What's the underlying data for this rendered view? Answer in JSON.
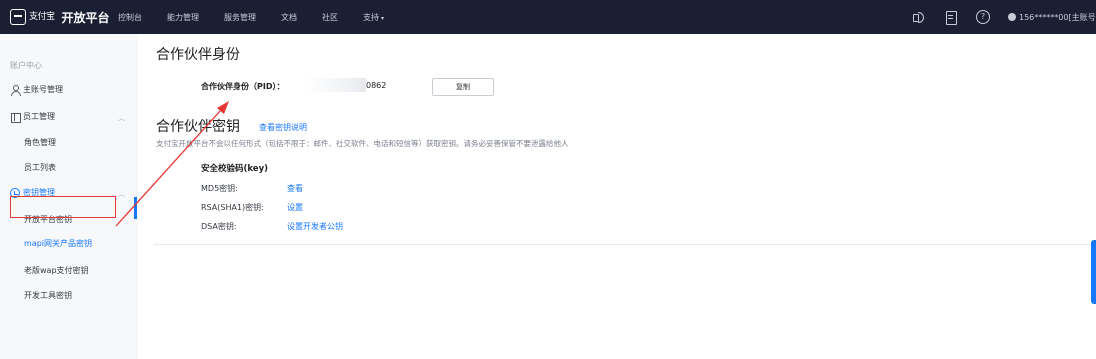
{
  "topbar": {
    "logo_text": "支付宝",
    "brand": "开放平台",
    "nav": [
      "控制台",
      "能力管理",
      "服务管理",
      "文档",
      "社区",
      "支持"
    ],
    "support_caret": "▾",
    "help_glyph": "?",
    "user": "156******00[主账号"
  },
  "sidebar": {
    "header": "账户中心",
    "items": [
      {
        "label": "主账号管理",
        "icon": "user-icon"
      },
      {
        "label": "员工管理",
        "icon": "staff-icon"
      },
      {
        "label": "角色管理"
      },
      {
        "label": "员工列表"
      },
      {
        "label": "密钥管理",
        "icon": "key-icon"
      },
      {
        "label": "开放平台密钥"
      },
      {
        "label": "mapi网关产品密钥"
      },
      {
        "label": "老版wap支付密钥"
      },
      {
        "label": "开发工具密钥"
      }
    ],
    "caret": "︿"
  },
  "main": {
    "pid_title": "合作伙伴身份",
    "pid_label": "合作伙伴身份（PID）：",
    "pid_value": "0862",
    "copy_button": "复制",
    "key_title": "合作伙伴密钥",
    "key_doc_link": "查看密钥说明",
    "key_desc": "支付宝开放平台不会以任何形式（包括不限于：邮件、社交软件、电话和短信等）获取密钥。请务必妥善保管不要泄露给他人",
    "section_heading": "安全校验码(key)",
    "rows": [
      {
        "label": "MD5密钥:",
        "action": "查看"
      },
      {
        "label": "RSA(SHA1)密钥:",
        "action": "设置"
      },
      {
        "label": "DSA密钥:",
        "action": "设置开发者公钥"
      }
    ]
  },
  "colors": {
    "topbar_bg": "#1b1f33",
    "accent": "#1677ff",
    "annotation_red": "#e53935"
  }
}
